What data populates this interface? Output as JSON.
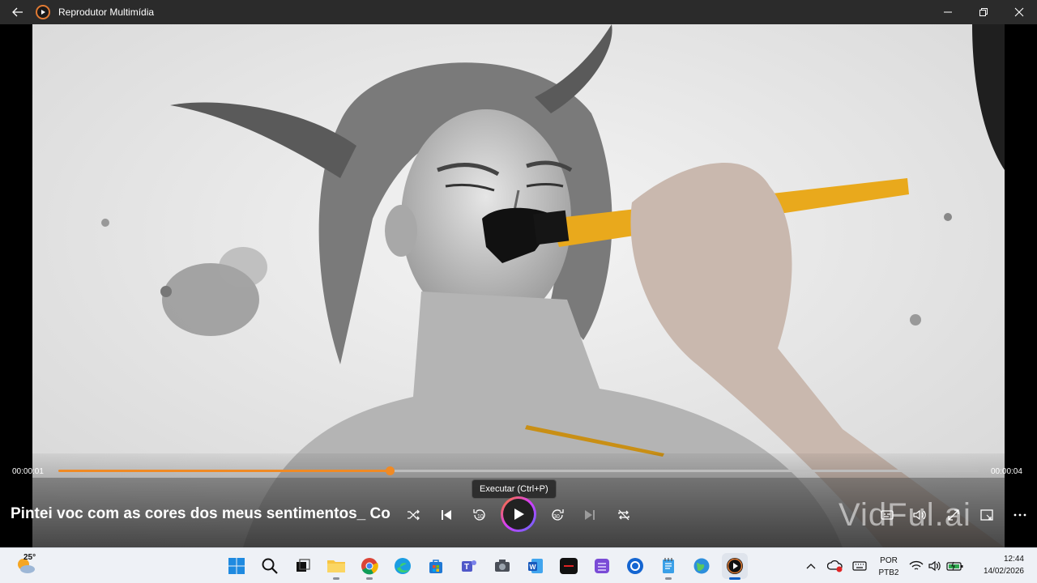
{
  "window": {
    "title": "Reprodutor Multimídia",
    "buttons": [
      "back",
      "minimize",
      "restore",
      "close"
    ]
  },
  "player": {
    "current_time": "00:00:01",
    "total_time": "00:00:04",
    "progress": 0.36,
    "media_title": "Pintei voc com as cores dos meus sentimentos_ Cont...",
    "tooltip": "Executar (Ctrl+P)",
    "watermark": "VidFul.ai",
    "controls": {
      "shuffle": "shuffle-icon",
      "previous": "skip-previous-icon",
      "rewind": "rewind-10-icon",
      "play": "play-icon",
      "forward": "forward-30-icon",
      "next": "skip-next-icon",
      "repeat": "repeat-icon",
      "captions": "captions-icon",
      "volume": "volume-icon",
      "fullscreen": "fullscreen-icon",
      "miniplayer": "mini-player-icon",
      "more": "more-options-icon"
    },
    "accent_color": "#f08a24"
  },
  "taskbar": {
    "weather_temp": "25°",
    "apps": [
      "start",
      "search",
      "task-view",
      "file-explorer",
      "chrome",
      "edge",
      "store",
      "teams",
      "camera",
      "word",
      "red-app",
      "clipchamp",
      "wifi-app",
      "notepad",
      "maps",
      "media-player"
    ],
    "tray": {
      "language_line1": "POR",
      "language_line2": "PTB2",
      "time": "12:44",
      "date": "14/02/2026"
    }
  }
}
